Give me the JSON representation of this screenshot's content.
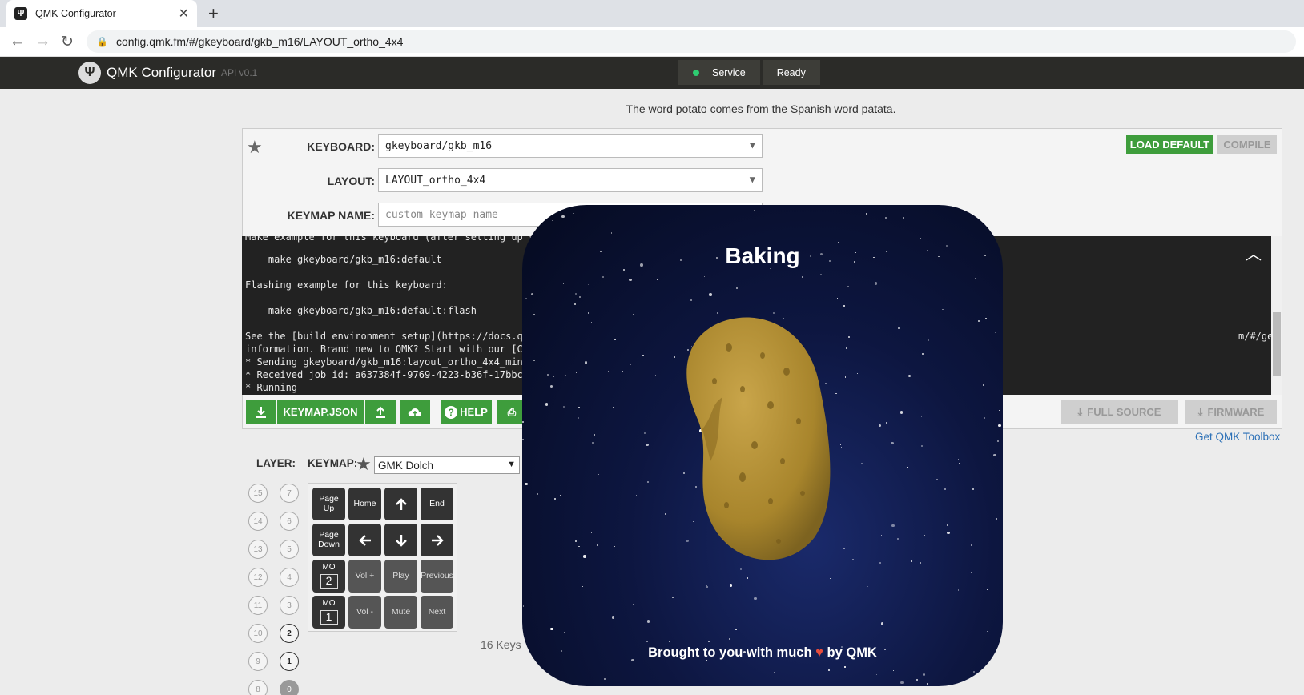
{
  "browser": {
    "tab_title": "QMK Configurator",
    "url": "config.qmk.fm/#/gkeyboard/gkb_m16/LAYOUT_ortho_4x4"
  },
  "header": {
    "app_name": "QMK Configurator",
    "api_version": "API v0.1",
    "service_label": "Service",
    "status_label": "Ready",
    "status_color": "#2ecc71"
  },
  "fact": "The word potato comes from the Spanish word patata.",
  "form": {
    "keyboard_label": "KEYBOARD:",
    "keyboard_value": "gkeyboard/gkb_m16",
    "layout_label": "LAYOUT:",
    "layout_value": "LAYOUT_ortho_4x4",
    "keymap_name_label": "KEYMAP NAME:",
    "keymap_name_placeholder": "custom keymap name",
    "load_default": "LOAD DEFAULT",
    "compile": "COMPILE"
  },
  "console": {
    "lines": [
      "Make example for this keyboard (after setting up your",
      "    make gkeyboard/gkb_m16:default",
      "Flashing example for this keyboard:",
      "    make gkeyboard/gkb_m16:default:flash",
      "See the [build environment setup](https://docs.q",
      "m/#/getting_started_make_guide) for more",
      "information. Brand new to QMK? Start with our [C",
      "* Sending gkeyboard/gkb_m16:layout_ortho_4x4_min",
      "* Received job_id: a637384f-9769-4223-b36f-17bbc",
      "* Running"
    ]
  },
  "actions": {
    "keymap_json": "KEYMAP.JSON",
    "help": "HELP",
    "full_source": "FULL SOURCE",
    "firmware": "FIRMWARE",
    "toolbox_link": "Get QMK Toolbox"
  },
  "layers": {
    "label": "LAYER:",
    "left_column": [
      "15",
      "14",
      "13",
      "12",
      "11",
      "10",
      "9",
      "8"
    ],
    "right_column": [
      "7",
      "6",
      "5",
      "4",
      "3",
      "2",
      "1",
      "0"
    ]
  },
  "keymap": {
    "label": "KEYMAP:",
    "selected": "GMK Dolch",
    "key_count": "16 Keys",
    "keys": [
      {
        "label": "Page\nUp"
      },
      {
        "label": "Home"
      },
      {
        "icon": "arrow-up-icon"
      },
      {
        "label": "End"
      },
      {
        "label": "Page\nDown"
      },
      {
        "icon": "arrow-left-icon"
      },
      {
        "icon": "arrow-down-icon"
      },
      {
        "icon": "arrow-right-icon"
      },
      {
        "mo": "MO",
        "num": "2"
      },
      {
        "label": "Vol +"
      },
      {
        "label": "Play"
      },
      {
        "label": "Previous"
      },
      {
        "mo": "MO",
        "num": "1"
      },
      {
        "label": "Vol -"
      },
      {
        "label": "Mute"
      },
      {
        "label": "Next"
      }
    ]
  },
  "overlay": {
    "title": "Baking",
    "footer_prefix": "Brought to you with much",
    "footer_suffix": "by QMK"
  }
}
